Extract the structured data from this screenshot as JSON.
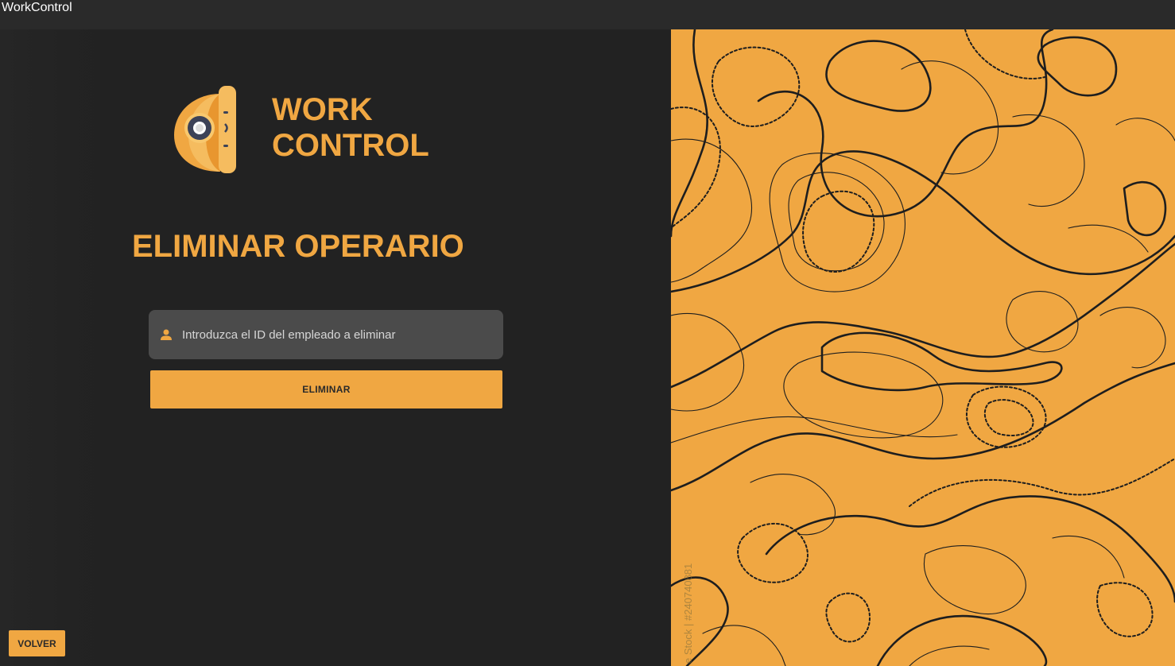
{
  "window": {
    "title": "WorkControl"
  },
  "brand": {
    "line1": "WORK",
    "line2": "CONTROL",
    "logo_icon": "hard-hat-icon"
  },
  "page": {
    "title": "ELIMINAR OPERARIO"
  },
  "form": {
    "employee_id_placeholder": "Introduzca el ID del empleado a eliminar",
    "employee_id_value": "",
    "field_icon": "user-icon",
    "submit_label": "ELIMINAR"
  },
  "footer": {
    "back_label": "VOLVER"
  },
  "decoration": {
    "pattern": "topographic-contour-lines",
    "watermark": "e Stock | #240740881"
  },
  "colors": {
    "accent": "#f0a742",
    "background": "#222222",
    "input_background": "#4b4b4b",
    "titlebar": "#2a2a2a",
    "contour_lines": "#1e1e1e"
  }
}
